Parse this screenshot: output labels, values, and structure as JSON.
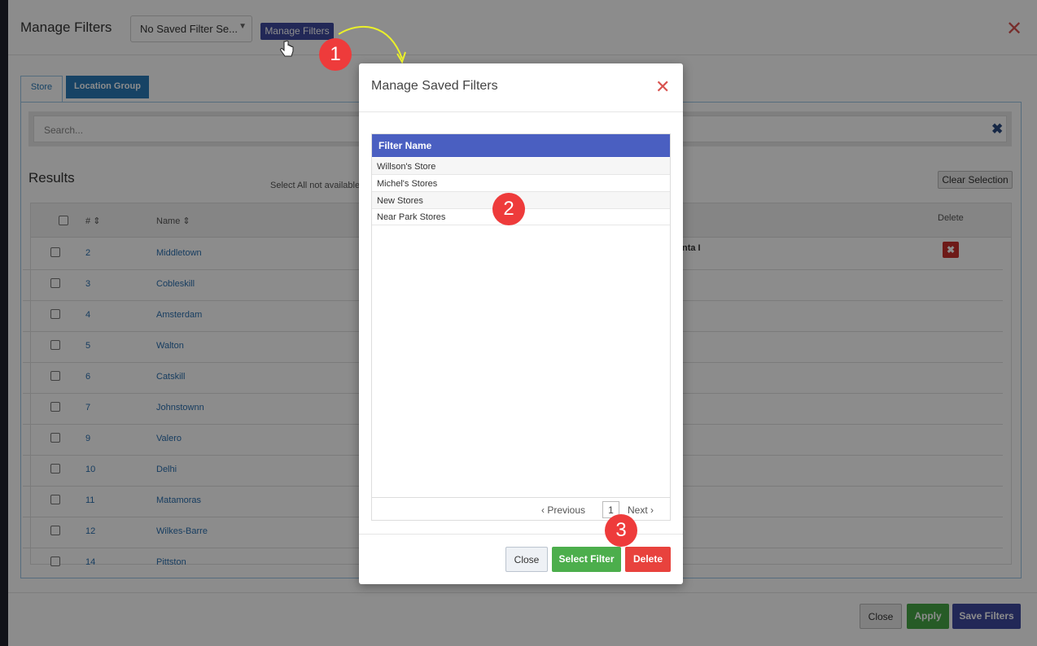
{
  "main_modal": {
    "title": "Manage Filters",
    "saved_filter_select": "No Saved Filter Se...",
    "manage_button": "Manage Filters",
    "tabs": [
      "Store",
      "Location Group"
    ],
    "search_placeholder": "Search...",
    "results_label": "Results",
    "select_all_note": "Select All not available",
    "clear_selection": "Clear Selection",
    "columns": {
      "num": "#",
      "name": "Name",
      "delete": "Delete"
    },
    "first_row_extra": "nta I",
    "rows": [
      {
        "num": "2",
        "name": "Middletown"
      },
      {
        "num": "3",
        "name": "Cobleskill"
      },
      {
        "num": "4",
        "name": "Amsterdam"
      },
      {
        "num": "5",
        "name": "Walton"
      },
      {
        "num": "6",
        "name": "Catskill"
      },
      {
        "num": "7",
        "name": "Johnstownn"
      },
      {
        "num": "9",
        "name": "Valero"
      },
      {
        "num": "10",
        "name": "Delhi"
      },
      {
        "num": "11",
        "name": "Matamoras"
      },
      {
        "num": "12",
        "name": "Wilkes-Barre"
      },
      {
        "num": "14",
        "name": "Pittston"
      }
    ],
    "footer": {
      "close": "Close",
      "apply": "Apply",
      "save": "Save Filters"
    }
  },
  "dialog": {
    "title": "Manage Saved Filters",
    "column_header": "Filter Name",
    "filters": [
      "Willson's Store",
      "Michel's Stores",
      "New Stores",
      "Near Park Stores"
    ],
    "pager": {
      "previous": "Previous",
      "page": "1",
      "next": "Next"
    },
    "buttons": {
      "close": "Close",
      "select": "Select Filter",
      "delete": "Delete"
    }
  },
  "annotations": [
    "1",
    "2",
    "3"
  ],
  "colors": {
    "primary": "#3f4a9e",
    "tab_active": "#2a7ab8",
    "list_header": "#4a5fc1",
    "success": "#4cae4c",
    "danger": "#e8423d",
    "marker": "#ee3b3b",
    "arrow": "#eaf02a"
  },
  "icons": [
    "close-icon",
    "chevron-down-icon",
    "sort-icon",
    "delete-icon",
    "chevron-left-icon",
    "chevron-right-icon",
    "hand-cursor-icon",
    "curved-arrow-icon"
  ]
}
